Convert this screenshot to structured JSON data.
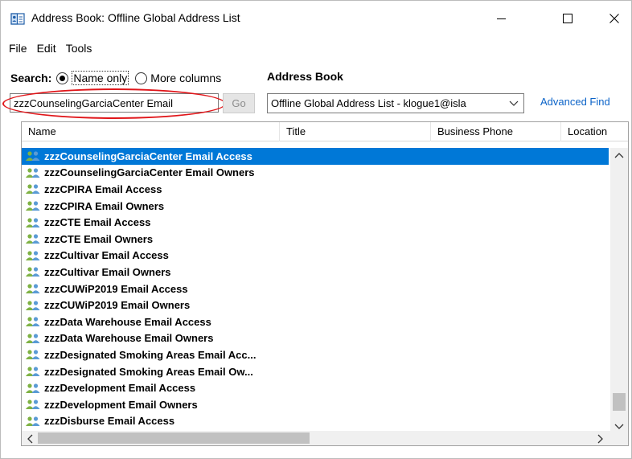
{
  "window": {
    "title": "Address Book: Offline Global Address List",
    "app_icon": "address-book-icon"
  },
  "menu": [
    "File",
    "Edit",
    "Tools"
  ],
  "search": {
    "label": "Search:",
    "option_name_only": "Name only",
    "option_more_columns": "More columns",
    "selected_option": "Name only",
    "input_value": "zzzCounselingGarciaCenter Email",
    "go_label": "Go"
  },
  "address_book": {
    "label": "Address Book",
    "selected": "Offline Global Address List - klogue1@isla",
    "advanced_find": "Advanced Find"
  },
  "columns": {
    "name": "Name",
    "title": "Title",
    "business_phone": "Business Phone",
    "location": "Location"
  },
  "rows": [
    "zzzCounselingGarciaCenter Email Access",
    "zzzCounselingGarciaCenter Email Owners",
    "zzzCPIRA Email Access",
    "zzzCPIRA Email Owners",
    "zzzCTE Email Access",
    "zzzCTE Email Owners",
    "zzzCultivar Email Access",
    "zzzCultivar Email Owners",
    "zzzCUWiP2019 Email Access",
    "zzzCUWiP2019 Email Owners",
    "zzzData Warehouse Email Access",
    "zzzData Warehouse Email Owners",
    "zzzDesignated Smoking Areas Email Acc...",
    "zzzDesignated Smoking Areas Email Ow...",
    "zzzDevelopment Email Access",
    "zzzDevelopment Email Owners",
    "zzzDisburse Email Access"
  ],
  "selected_row_index": 0,
  "colors": {
    "selection": "#0078d7",
    "link": "#0b63c8",
    "highlight": "#e0161a"
  }
}
